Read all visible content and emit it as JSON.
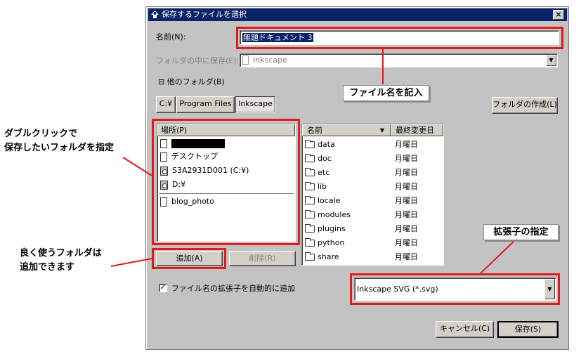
{
  "dialog": {
    "title": "保存するファイルを選択",
    "close_label": "×",
    "name_label": "名前(N):",
    "filename_value": "無題ドキュメント 3",
    "save_in_label": "フォルダの中に保存(E):",
    "save_in_value": "Inkscape",
    "other_folders_toggle": "⊟",
    "other_folders_label": "他のフォルダ(B)",
    "path_buttons": [
      "C:¥",
      "Program Files",
      "Inkscape"
    ],
    "create_folder_label": "フォルダの作成(L)",
    "places_header": "場所(P)",
    "places": [
      "",
      "デスクトップ",
      "S3A2931D001 (C:¥)",
      "D:¥",
      "blog_photo"
    ],
    "files_header_name": "名前",
    "files_header_modified": "最終変更日",
    "files": [
      {
        "name": "data",
        "modified": "月曜日"
      },
      {
        "name": "doc",
        "modified": "月曜日"
      },
      {
        "name": "etc",
        "modified": "月曜日"
      },
      {
        "name": "lib",
        "modified": "月曜日"
      },
      {
        "name": "locale",
        "modified": "月曜日"
      },
      {
        "name": "modules",
        "modified": "月曜日"
      },
      {
        "name": "plugins",
        "modified": "月曜日"
      },
      {
        "name": "python",
        "modified": "月曜日"
      },
      {
        "name": "share",
        "modified": "月曜日"
      }
    ],
    "add_label": "追加(A)",
    "remove_label": "削除(R)",
    "auto_extension_label": "ファイル名の拡張子を自動的に追加",
    "auto_extension_checked": "✓",
    "filetype_value": "Inkscape SVG (*.svg)",
    "cancel_label": "キャンセル(C)",
    "save_label": "保存(S)"
  },
  "annotations": {
    "filename_callout": "ファイル名を記入",
    "extension_callout": "拡張子の指定",
    "double_click_line1": "ダブルクリックで",
    "double_click_line2": "保存したいフォルダを指定",
    "add_line1": "良く使うフォルダは",
    "add_line2": "追加できます"
  },
  "colors": {
    "highlight": "#e11b1b",
    "titlebar": "#0a246a",
    "selection": "#0a246a"
  }
}
